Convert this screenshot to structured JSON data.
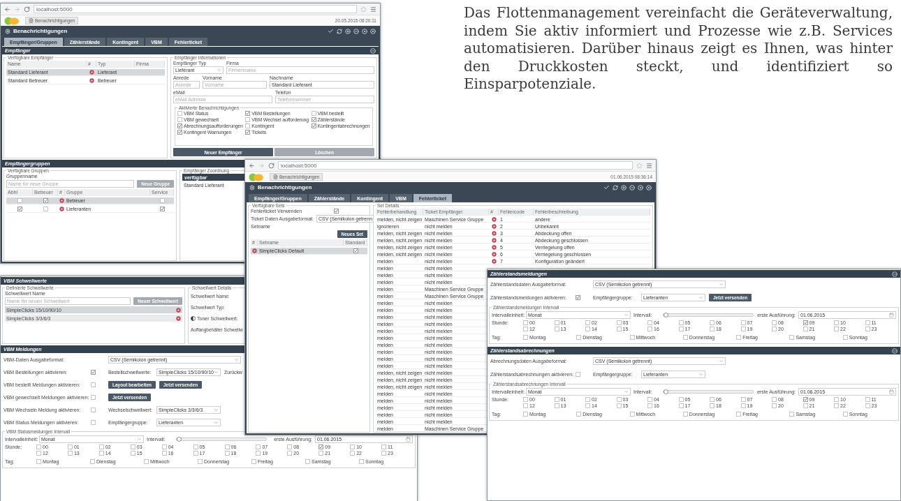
{
  "intro": {
    "text": "Das Flottenmanagement vereinfacht die Geräteverwaltung, indem Sie aktiv informiert und Prozesse wie z.B. Services automatisieren. Darüber hinaus zeigt es Ihnen, was hinter den Druckkosten steckt, und identifiziert so Einsparpotenziale."
  },
  "window_recipients": {
    "browser": {
      "url": "localhost:5000",
      "tab": "Benachrichtigungen",
      "timestamp": "20.05.2015 08:20:11"
    },
    "title": "Benachrichtigungen",
    "tabs": [
      {
        "label": "Empfänger/Gruppen",
        "selected": true
      },
      {
        "label": "Zählerstände",
        "selected": false
      },
      {
        "label": "Kontingent",
        "selected": false
      },
      {
        "label": "VBM",
        "selected": false
      },
      {
        "label": "Fehlerticket",
        "selected": false
      }
    ],
    "recipients_section": {
      "title": "Empfänger",
      "list": {
        "legend": "Verfügbare Empfänger",
        "columns": [
          "Name",
          "#",
          "Typ",
          "Firma"
        ],
        "rows": [
          {
            "name": "Standard Lieferant",
            "type": "Lieferant",
            "selected": true
          },
          {
            "name": "Standard Betreuer",
            "type": "Betreuer",
            "selected": false
          }
        ]
      },
      "info": {
        "legend": "Empfänger Informationen",
        "field_rows": [
          [
            {
              "label": "Empfänger Typ",
              "kind": "select",
              "value": "Lieferant"
            },
            {
              "label": "Firma",
              "kind": "input",
              "placeholder": "Firmenname"
            }
          ],
          [
            {
              "label": "Anrede",
              "kind": "input",
              "placeholder": "Anrede"
            },
            {
              "label": "Vorname",
              "kind": "input",
              "placeholder": "Vorname"
            },
            {
              "label": "Nachname",
              "kind": "input",
              "value": "Standard Lieferant"
            }
          ],
          [
            {
              "label": "eMail",
              "kind": "input",
              "placeholder": "eMail Adresse"
            },
            {
              "label": "Telefon",
              "kind": "input",
              "placeholder": "Telefonnummer"
            }
          ]
        ]
      },
      "notifications": {
        "legend": "Aktivierte Benachrichtigungen",
        "items": [
          {
            "label": "VBM Status",
            "checked": false
          },
          {
            "label": "VBM Bestellungen",
            "checked": true
          },
          {
            "label": "VBM bestellt",
            "checked": false
          },
          {
            "label": "VBM gewechselt",
            "checked": false
          },
          {
            "label": "VBM Wechsel aufforderung",
            "checked": false
          },
          {
            "label": "Zählerstände",
            "checked": true
          },
          {
            "label": "Abrechnungsaufforderungen",
            "checked": true
          },
          {
            "label": "Kontingent",
            "checked": false
          },
          {
            "label": "Kontingentabrechnungen",
            "checked": true
          },
          {
            "label": "Kontingent Warnungen",
            "checked": true
          },
          {
            "label": "Tickets",
            "checked": true
          }
        ]
      },
      "buttons": [
        {
          "label": "Neuer Empfänger",
          "kind": "primary"
        },
        {
          "label": "Löschen",
          "kind": "secondary"
        }
      ]
    },
    "groups_section": {
      "title": "Empfängergruppen",
      "legend": "Verfügbare Gruppen",
      "name_label": "Gruppenname",
      "name_placeholder": "Name für neue Gruppe",
      "add_button": "Neue Gruppe",
      "columns": [
        "Abhl",
        "Betreuer",
        "#",
        "Gruppe",
        "Service"
      ],
      "rows": [
        {
          "abhl": false,
          "betreuer": true,
          "name": "Betreuer",
          "service": false,
          "selected": true
        },
        {
          "abhl": true,
          "betreuer": false,
          "name": "Lieferanten",
          "service": true,
          "selected": false
        }
      ],
      "assignment": {
        "legend": "Empfänger Zuordnung",
        "header": "verfügbar",
        "items": [
          "Standard Lieferant"
        ]
      }
    }
  },
  "window_tickets": {
    "browser": {
      "url": "localhost:5000",
      "tab": "Benachrichtigungen",
      "timestamp": "01.06.2015 08:36:14"
    },
    "title": "Benachrichtigungen",
    "tabs": [
      {
        "label": "Empfänger/Gruppen",
        "selected": false
      },
      {
        "label": "Zählerstände",
        "selected": false
      },
      {
        "label": "Kontingent",
        "selected": false
      },
      {
        "label": "VBM",
        "selected": false
      },
      {
        "label": "Fehlerticket",
        "selected": true
      }
    ],
    "sets": {
      "legend": "Verfügbare Sets",
      "enable_label": "Fehlerticket Verwenden",
      "enabled": true,
      "format_label": "Ticket Daten Ausgabeformat:",
      "format": "CSV (Semikolon getrenn",
      "setname_label": "Setname",
      "add_button": "Neues Set",
      "columns": [
        "#",
        "Setname",
        "Standard"
      ],
      "rows": [
        {
          "name": "SimpleClicks Default",
          "default": true,
          "selected": true
        }
      ]
    },
    "details": {
      "legend": "Set Details",
      "columns": [
        "Fehlerbehandlung",
        "Ticket Empfänger",
        "#",
        "Fehlercode",
        "Fehlerbeschreibung"
      ],
      "rows": [
        {
          "handling": "melden, nicht zeigen",
          "recipient": "Maschinen Service Gruppe",
          "code": "1",
          "description": "andere"
        },
        {
          "handling": "ignorieren",
          "recipient": "nicht melden",
          "code": "2",
          "description": "Unbekannt"
        },
        {
          "handling": "melden, nicht zeigen",
          "recipient": "nicht melden",
          "code": "3",
          "description": "Abdeckung offen"
        },
        {
          "handling": "melden, nicht zeigen",
          "recipient": "nicht melden",
          "code": "4",
          "description": "Abdeckung geschlossen"
        },
        {
          "handling": "melden, nicht zeigen",
          "recipient": "nicht melden",
          "code": "5",
          "description": "Verriegelung offen"
        },
        {
          "handling": "melden, nicht zeigen",
          "recipient": "nicht melden",
          "code": "6",
          "description": "Verriegelung geschlossen"
        },
        {
          "handling": "melden",
          "recipient": "nicht melden",
          "code": "7",
          "description": "Konfiguration geändert"
        },
        {
          "handling": "melden",
          "recipient": "nicht melden"
        },
        {
          "handling": "melden",
          "recipient": "nicht melden"
        },
        {
          "handling": "melden",
          "recipient": "nicht melden"
        },
        {
          "handling": "melden",
          "recipient": "Maschinen Service Gruppe"
        },
        {
          "handling": "melden",
          "recipient": "Maschinen Service Gruppe"
        },
        {
          "handling": "melden",
          "recipient": "nicht melden"
        },
        {
          "handling": "melden",
          "recipient": "nicht melden"
        },
        {
          "handling": "melden",
          "recipient": "nicht melden"
        },
        {
          "handling": "melden",
          "recipient": "nicht melden"
        },
        {
          "handling": "melden",
          "recipient": "nicht melden"
        },
        {
          "handling": "melden",
          "recipient": "nicht melden"
        },
        {
          "handling": "melden",
          "recipient": "nicht melden"
        },
        {
          "handling": "melden",
          "recipient": "nicht melden"
        },
        {
          "handling": "melden",
          "recipient": "nicht melden"
        },
        {
          "handling": "melden",
          "recipient": "nicht melden"
        },
        {
          "handling": "melden, nicht zeigen",
          "recipient": "nicht melden"
        },
        {
          "handling": "melden, nicht zeigen",
          "recipient": "nicht melden"
        },
        {
          "handling": "melden, nicht zeigen",
          "recipient": "nicht melden"
        },
        {
          "handling": "melden",
          "recipient": "nicht melden"
        },
        {
          "handling": "melden",
          "recipient": "nicht melden"
        },
        {
          "handling": "melden",
          "recipient": "nicht melden"
        },
        {
          "handling": "melden",
          "recipient": "nicht melden"
        },
        {
          "handling": "melden",
          "recipient": "nicht melden"
        },
        {
          "handling": "melden",
          "recipient": "Maschinen Service Gruppe"
        }
      ]
    }
  },
  "window_vbm": {
    "thresholds": {
      "title": "VBM Schwellwerte",
      "legend": "Definierte Schwellwerte",
      "name_label": "Schwellwert Name",
      "name_placeholder": "Name für neuen Schwellwert",
      "add_button": "Neuer Schwellwert",
      "items": [
        {
          "name": "SimpleClicks 15/10/90/10",
          "selected": true
        },
        {
          "name": "SimpleClicks 3/3/6/3",
          "selected": false
        }
      ],
      "details": {
        "legend": "Schwellwert Details",
        "lines": [
          {
            "kind": "label",
            "text": "Schwellwert Name:"
          },
          {
            "kind": "label",
            "text": "Schwellwert Typ:"
          },
          {
            "kind": "toner",
            "text": "Toner Schwellwert:"
          },
          {
            "kind": "label",
            "text": "Auffangbehälter Schwellw"
          }
        ]
      }
    },
    "messages": {
      "title": "VBM Meldungen",
      "rows": [
        {
          "label": "VBM-Daten Ausgabeformat:",
          "items": [
            {
              "kind": "wide_select",
              "text": "CSV (Semikolon getrennt)"
            }
          ]
        },
        {
          "label": "VBM Bestellungen aktivieren:",
          "checked": true,
          "items": [
            {
              "kind": "label",
              "text": "Bestellschwellwerte:"
            },
            {
              "kind": "select",
              "text": "SimpleClicks 15/10/90/10"
            },
            {
              "kind": "label",
              "text": "Zurückw"
            }
          ]
        },
        {
          "label": "VBM bestellt Meldungen aktivieren:",
          "checked": false,
          "items": [
            {
              "kind": "button",
              "text": "Layout bearbeiten"
            },
            {
              "kind": "button",
              "text": "Jetzt versenden"
            }
          ]
        },
        {
          "label": "VBM gewechselt Meldungen aktivieren:",
          "checked": false,
          "items": [
            {
              "kind": "button",
              "text": "Jetzt versenden"
            }
          ]
        },
        {
          "label": "VBM Wechseln Meldung aktivieren:",
          "checked": false,
          "items": [
            {
              "kind": "label",
              "text": "Wechselschwellwert:"
            },
            {
              "kind": "select",
              "text": "SimpleClicks 3/3/6/3"
            }
          ]
        },
        {
          "label": "VBM Status Meldungen aktivieren:",
          "checked": false,
          "items": [
            {
              "kind": "label",
              "text": "Empfängergruppe:"
            },
            {
              "kind": "select",
              "text": "Lieferanten"
            }
          ]
        }
      ]
    },
    "interval": {
      "legend": "VBM Statusmeldungen Intervall",
      "unit_label": "Intervalleinheit:",
      "unit": "Monat",
      "interval_label": "Intervall:",
      "level": 0.02,
      "first_label": "erste Ausführung:",
      "first": "01.06.2015",
      "hour_label": "Stunde:",
      "hours": [
        {
          "label": "00",
          "checked": false
        },
        {
          "label": "01",
          "checked": false
        },
        {
          "label": "02",
          "checked": false
        },
        {
          "label": "03",
          "checked": false
        },
        {
          "label": "04",
          "checked": false
        },
        {
          "label": "05",
          "checked": false
        },
        {
          "label": "06",
          "checked": false
        },
        {
          "label": "07",
          "checked": false
        },
        {
          "label": "08",
          "checked": false
        },
        {
          "label": "09",
          "checked": true
        },
        {
          "label": "10",
          "checked": false
        },
        {
          "label": "11",
          "checked": false
        },
        {
          "label": "12",
          "checked": false
        },
        {
          "label": "13",
          "checked": false
        },
        {
          "label": "14",
          "checked": false
        },
        {
          "label": "15",
          "checked": false
        },
        {
          "label": "16",
          "checked": false
        },
        {
          "label": "17",
          "checked": false
        },
        {
          "label": "18",
          "checked": false
        },
        {
          "label": "19",
          "checked": false
        },
        {
          "label": "20",
          "checked": false
        },
        {
          "label": "21",
          "checked": false
        },
        {
          "label": "22",
          "checked": false
        },
        {
          "label": "23",
          "checked": false
        }
      ],
      "day_label": "Tag:",
      "days": [
        {
          "label": "Montag",
          "checked": false
        },
        {
          "label": "Dienstag",
          "checked": false
        },
        {
          "label": "Mittwoch",
          "checked": false
        },
        {
          "label": "Donnerstag",
          "checked": false
        },
        {
          "label": "Freitag",
          "checked": false
        },
        {
          "label": "Samstag",
          "checked": false
        },
        {
          "label": "Sonntag",
          "checked": false
        }
      ]
    }
  },
  "window_counters": {
    "sections": [
      {
        "title": "Zählerstandsmeldungen",
        "rows": [
          {
            "label": "Zählerstandsdaten Ausgabeformat:",
            "items": [
              {
                "kind": "wide_select",
                "text": "CSV (Semikolon getrennt)"
              }
            ]
          },
          {
            "label": "Zählerstandsmeldungen aktivieren:",
            "checked": true,
            "items": [
              {
                "kind": "label",
                "text": "Empfängergruppe:"
              },
              {
                "kind": "select",
                "text": "Lieferanten"
              },
              {
                "kind": "button",
                "text": "Jetzt versenden"
              }
            ]
          }
        ],
        "interval": {
          "legend": "Zählerstandsmeldungen Intervall",
          "unit_label": "Intervalleinheit:",
          "unit": "Monat",
          "interval_label": "Intervall:",
          "level": 0.02,
          "first_label": "erste Ausführung:",
          "first": "01.06.2015",
          "hour_label": "Stunde:",
          "hours": [
            {
              "label": "00",
              "checked": false
            },
            {
              "label": "01",
              "checked": false
            },
            {
              "label": "02",
              "checked": false
            },
            {
              "label": "03",
              "checked": false
            },
            {
              "label": "04",
              "checked": false
            },
            {
              "label": "05",
              "checked": false
            },
            {
              "label": "06",
              "checked": false
            },
            {
              "label": "07",
              "checked": false
            },
            {
              "label": "08",
              "checked": false
            },
            {
              "label": "09",
              "checked": true
            },
            {
              "label": "10",
              "checked": false
            },
            {
              "label": "11",
              "checked": false
            },
            {
              "label": "12",
              "checked": false
            },
            {
              "label": "13",
              "checked": false
            },
            {
              "label": "14",
              "checked": false
            },
            {
              "label": "15",
              "checked": false
            },
            {
              "label": "16",
              "checked": false
            },
            {
              "label": "17",
              "checked": false
            },
            {
              "label": "18",
              "checked": false
            },
            {
              "label": "19",
              "checked": false
            },
            {
              "label": "20",
              "checked": false
            },
            {
              "label": "21",
              "checked": false
            },
            {
              "label": "22",
              "checked": false
            },
            {
              "label": "23",
              "checked": false
            }
          ],
          "day_label": "Tag:",
          "days": [
            {
              "label": "Montag",
              "checked": false
            },
            {
              "label": "Dienstag",
              "checked": false
            },
            {
              "label": "Mittwoch",
              "checked": false
            },
            {
              "label": "Donnerstag",
              "checked": false
            },
            {
              "label": "Freitag",
              "checked": false
            },
            {
              "label": "Samstag",
              "checked": false
            },
            {
              "label": "Sonntag",
              "checked": false
            }
          ]
        }
      },
      {
        "title": "Zählerstandsabrechnungen",
        "rows": [
          {
            "label": "Abrechnungsdaten Ausgabeformat:",
            "items": [
              {
                "kind": "wide_select",
                "text": "CSV (Semikolon getrennt)"
              }
            ]
          },
          {
            "label": "Zählerstandsabrechnungen aktivieren:",
            "checked": false,
            "items": [
              {
                "kind": "label",
                "text": "Empfängergruppe:"
              },
              {
                "kind": "select",
                "text": "Lieferanten"
              }
            ]
          }
        ],
        "interval": {
          "legend": "Zählerstandsabrechnungen Intervall",
          "unit_label": "Intervalleinheit:",
          "unit": "Monat",
          "interval_label": "Intervall:",
          "level": 0.02,
          "first_label": "erste Ausführung:",
          "first": "01.06.2015",
          "hour_label": "Stunde:",
          "hours": [
            {
              "label": "00",
              "checked": false
            },
            {
              "label": "01",
              "checked": false
            },
            {
              "label": "02",
              "checked": false
            },
            {
              "label": "03",
              "checked": false
            },
            {
              "label": "04",
              "checked": false
            },
            {
              "label": "05",
              "checked": false
            },
            {
              "label": "06",
              "checked": false
            },
            {
              "label": "07",
              "checked": false
            },
            {
              "label": "08",
              "checked": false
            },
            {
              "label": "09",
              "checked": true
            },
            {
              "label": "10",
              "checked": false
            },
            {
              "label": "11",
              "checked": false
            },
            {
              "label": "12",
              "checked": false
            },
            {
              "label": "13",
              "checked": false
            },
            {
              "label": "14",
              "checked": false
            },
            {
              "label": "15",
              "checked": false
            },
            {
              "label": "16",
              "checked": false
            },
            {
              "label": "17",
              "checked": false
            },
            {
              "label": "18",
              "checked": false
            },
            {
              "label": "19",
              "checked": false
            },
            {
              "label": "20",
              "checked": false
            },
            {
              "label": "21",
              "checked": false
            },
            {
              "label": "22",
              "checked": false
            },
            {
              "label": "23",
              "checked": false
            }
          ],
          "day_label": "Tag:",
          "days": [
            {
              "label": "Montag",
              "checked": false
            },
            {
              "label": "Dienstag",
              "checked": false
            },
            {
              "label": "Mittwoch",
              "checked": false
            },
            {
              "label": "Donnerstag",
              "checked": false
            },
            {
              "label": "Freitag",
              "checked": false
            },
            {
              "label": "Samstag",
              "checked": false
            },
            {
              "label": "Sonntag",
              "checked": false
            }
          ]
        }
      }
    ]
  }
}
